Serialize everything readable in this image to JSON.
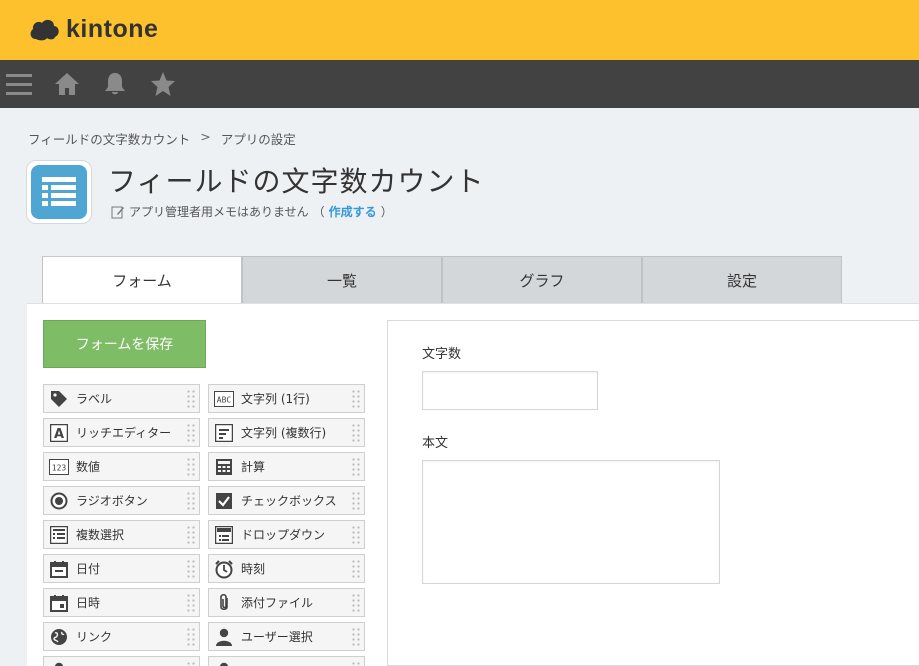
{
  "header": {
    "logo_text": "kintone"
  },
  "nav": {
    "icons": [
      "menu-icon",
      "home-icon",
      "bell-icon",
      "star-icon"
    ]
  },
  "breadcrumb": {
    "item1": "フィールドの文字数カウント",
    "separator": ">",
    "item2": "アプリの設定"
  },
  "app": {
    "title": "フィールドの文字数カウント",
    "memo_text": "アプリ管理者用メモはありません",
    "memo_open": "（",
    "memo_link": "作成する",
    "memo_close": "）"
  },
  "tabs": [
    "フォーム",
    "一覧",
    "グラフ",
    "設定"
  ],
  "save_button": "フォームを保存",
  "palette": [
    {
      "label": "ラベル",
      "icon": "tag-icon"
    },
    {
      "label": "文字列 (1行)",
      "icon": "abc-icon"
    },
    {
      "label": "リッチエディター",
      "icon": "rich-editor-icon"
    },
    {
      "label": "文字列 (複数行)",
      "icon": "multiline-icon"
    },
    {
      "label": "数値",
      "icon": "number-icon"
    },
    {
      "label": "計算",
      "icon": "calculator-icon"
    },
    {
      "label": "ラジオボタン",
      "icon": "radio-icon"
    },
    {
      "label": "チェックボックス",
      "icon": "checkbox-icon"
    },
    {
      "label": "複数選択",
      "icon": "multi-select-icon"
    },
    {
      "label": "ドロップダウン",
      "icon": "dropdown-icon"
    },
    {
      "label": "日付",
      "icon": "calendar-icon"
    },
    {
      "label": "時刻",
      "icon": "clock-icon"
    },
    {
      "label": "日時",
      "icon": "datetime-icon"
    },
    {
      "label": "添付ファイル",
      "icon": "paperclip-icon"
    },
    {
      "label": "リンク",
      "icon": "globe-icon"
    },
    {
      "label": "ユーザー選択",
      "icon": "user-icon"
    }
  ],
  "form": {
    "field1_label": "文字数",
    "field2_label": "本文"
  },
  "colors": {
    "header": "#fdc12d",
    "nav": "#424242",
    "accent": "#7ebd66",
    "link": "#3498db"
  }
}
